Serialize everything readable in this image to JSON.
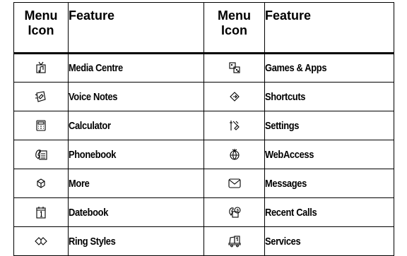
{
  "headers": {
    "menu_icon": "Menu\nIcon",
    "menu_icon_line1": "Menu",
    "menu_icon_line2": "Icon",
    "feature": "Feature"
  },
  "rows": [
    {
      "left": {
        "icon": "media-centre-icon",
        "feature": "Media Centre"
      },
      "right": {
        "icon": "games-apps-icon",
        "feature": "Games & Apps"
      }
    },
    {
      "left": {
        "icon": "voice-notes-icon",
        "feature": "Voice Notes"
      },
      "right": {
        "icon": "shortcuts-icon",
        "feature": "Shortcuts"
      }
    },
    {
      "left": {
        "icon": "calculator-icon",
        "feature": "Calculator"
      },
      "right": {
        "icon": "settings-icon",
        "feature": "Settings"
      }
    },
    {
      "left": {
        "icon": "phonebook-icon",
        "feature": "Phonebook"
      },
      "right": {
        "icon": "webaccess-icon",
        "feature": "WebAccess"
      }
    },
    {
      "left": {
        "icon": "more-icon",
        "feature": "More"
      },
      "right": {
        "icon": "messages-icon",
        "feature": "Messages"
      }
    },
    {
      "left": {
        "icon": "datebook-icon",
        "feature": "Datebook"
      },
      "right": {
        "icon": "recent-calls-icon",
        "feature": "Recent Calls"
      }
    },
    {
      "left": {
        "icon": "ring-styles-icon",
        "feature": "Ring Styles"
      },
      "right": {
        "icon": "services-icon",
        "feature": "Services"
      }
    }
  ]
}
